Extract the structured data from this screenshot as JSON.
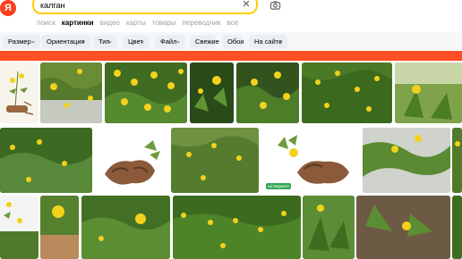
{
  "header": {
    "logo_letter": "Я",
    "search_value": "калган"
  },
  "tabs": [
    {
      "label": "поиск"
    },
    {
      "label": "картинки"
    },
    {
      "label": "видео"
    },
    {
      "label": "карты"
    },
    {
      "label": "товары"
    },
    {
      "label": "переводчик"
    },
    {
      "label": "все"
    }
  ],
  "filters": [
    {
      "label": "Размер"
    },
    {
      "label": "Ориентация"
    },
    {
      "label": "Тип"
    },
    {
      "label": "Цвет"
    },
    {
      "label": "Файл"
    },
    {
      "label": "Свежие"
    },
    {
      "label": "Обои"
    },
    {
      "label": "На сайте"
    }
  ],
  "results": {
    "market_badge": "на Маркете"
  },
  "colors": {
    "brand": "#fc3f1d",
    "search_border": "#ffcc00",
    "accent_band": "#ff4f24",
    "foliage": "#4f7a2a",
    "flower": "#f2d21b",
    "root": "#8a5a3a"
  },
  "icons": [
    "clear-icon",
    "camera-icon",
    "chevron-down-icon"
  ]
}
